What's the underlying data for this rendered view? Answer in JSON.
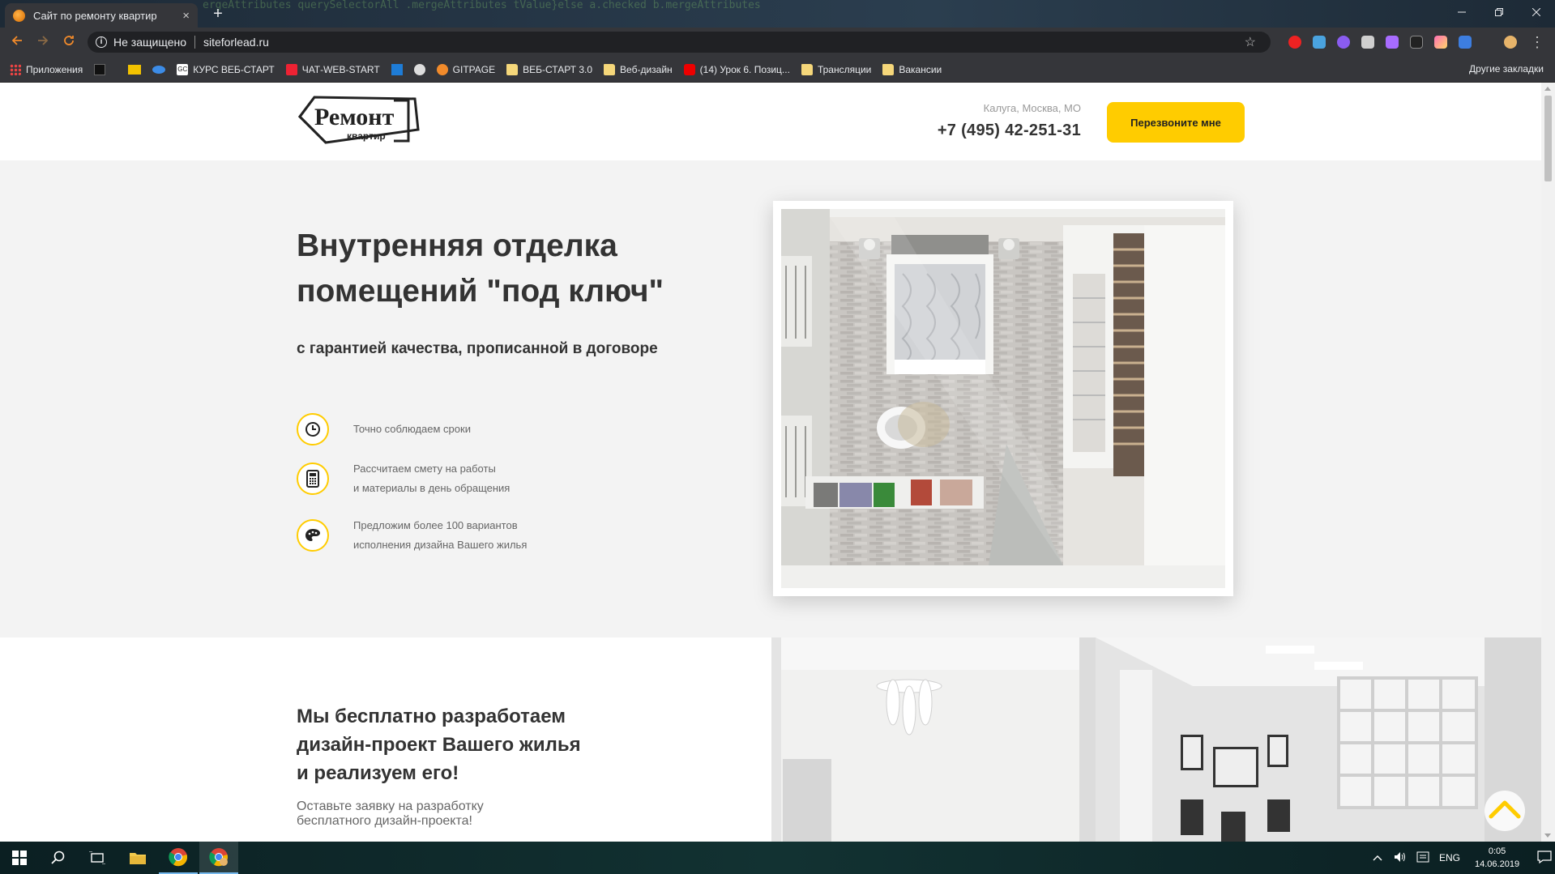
{
  "browser": {
    "tab_title": "Сайт по ремонту квартир",
    "tab_close": "×",
    "new_tab": "+",
    "security_label": "Не защищено",
    "url": "siteforlead.ru",
    "code_bg_text": "ergeAttributes   querySelectorAll  .mergeAttributes tValue}else  a.checked  b.mergeAttributes"
  },
  "bookmarks": {
    "apps": "Приложения",
    "items": [
      {
        "label": "КУРС ВЕБ-СТАРТ"
      },
      {
        "label": "ЧАТ-WEB-START"
      },
      {
        "label": "GITPAGE"
      },
      {
        "label": "ВЕБ-СТАРТ 3.0"
      },
      {
        "label": "Веб-дизайн"
      },
      {
        "label": "(14) Урок 6. Позиц..."
      },
      {
        "label": "Трансляции"
      },
      {
        "label": "Вакансии"
      }
    ],
    "other": "Другие закладки"
  },
  "site": {
    "logo_word": "Ремонт",
    "logo_sub": "квартир",
    "region": "Калуга, Москва, МО",
    "phone": "+7 (495) 42-251-31",
    "cta": "Перезвоните мне",
    "hero": {
      "title": "Внутренняя отделка помещений \"под ключ\"",
      "subtitle": "с гарантией качества, прописанной в договоре",
      "features": [
        {
          "icon": "clock-icon",
          "line1": "Точно соблюдаем сроки",
          "line2": ""
        },
        {
          "icon": "calculator-icon",
          "line1": "Рассчитаем смету на работы",
          "line2": "и материалы в день обращения"
        },
        {
          "icon": "palette-icon",
          "line1": "Предложим более 100 вариантов",
          "line2": "исполнения дизайна Вашего жилья"
        }
      ]
    },
    "design": {
      "title_l1": "Мы бесплатно разработаем",
      "title_l2": "дизайн-проект Вашего жилья",
      "title_l3": "и реализуем его!",
      "text_l1": "Оставьте заявку на разработку",
      "text_l2": "бесплатного дизайн-проекта!"
    }
  },
  "taskbar": {
    "lang": "ENG",
    "time": "0:05",
    "date": "14.06.2019"
  },
  "colors": {
    "accent": "#ffcc00",
    "text_dark": "#333333",
    "text_muted": "#666666",
    "hero_bg": "#f3f3f3"
  }
}
